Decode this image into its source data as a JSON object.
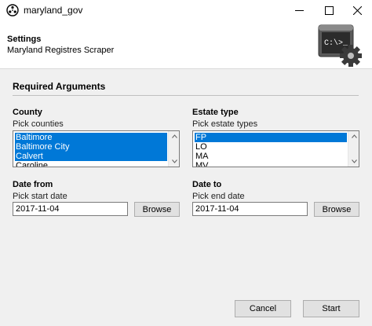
{
  "window": {
    "title": "maryland_gov"
  },
  "header": {
    "title": "Settings",
    "subtitle": "Maryland Registres Scraper"
  },
  "section": {
    "title": "Required Arguments"
  },
  "county": {
    "label": "County",
    "help": "Pick counties",
    "items": [
      {
        "label": "Baltimore",
        "selected": true
      },
      {
        "label": "Baltimore City",
        "selected": true
      },
      {
        "label": "Calvert",
        "selected": true
      },
      {
        "label": "Caroline",
        "selected": false
      }
    ]
  },
  "estate_type": {
    "label": "Estate type",
    "help": "Pick estate types",
    "items": [
      {
        "label": "FP",
        "selected": true
      },
      {
        "label": "LO",
        "selected": false
      },
      {
        "label": "MA",
        "selected": false
      },
      {
        "label": "MV",
        "selected": false
      }
    ]
  },
  "date_from": {
    "label": "Date from",
    "help": "Pick start date",
    "value": "2017-11-04",
    "browse_label": "Browse"
  },
  "date_to": {
    "label": "Date to",
    "help": "Pick end date",
    "value": "2017-11-04",
    "browse_label": "Browse"
  },
  "footer": {
    "cancel_label": "Cancel",
    "start_label": "Start"
  },
  "colors": {
    "selection": "#0078d7",
    "content_bg": "#f0f0f0"
  }
}
